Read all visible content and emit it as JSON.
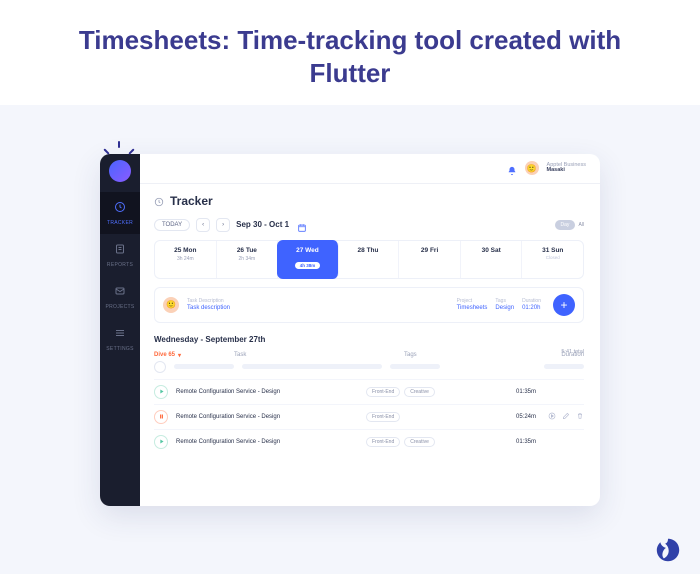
{
  "headline": "Timesheets: Time-tracking tool created with Flutter",
  "header": {
    "breadcrumb": "Apptel Business",
    "user_name": "Masaki"
  },
  "sidebar": {
    "items": [
      {
        "label": "TRACKER",
        "icon": "clock"
      },
      {
        "label": "REPORTS",
        "icon": "report"
      },
      {
        "label": "PROJECTS",
        "icon": "mail"
      },
      {
        "label": "SETTINGS",
        "icon": "stack"
      }
    ]
  },
  "tracker": {
    "title": "Tracker",
    "today_btn": "TODAY",
    "date_range": "Sep 30 - Oct 1",
    "toggle_active": "Day",
    "toggle_other": "All",
    "week": [
      {
        "label": "25 Mon",
        "dur": "3h 24m"
      },
      {
        "label": "26 Tue",
        "dur": "2h 34m"
      },
      {
        "label": "27 Wed",
        "badge": "4h 38m",
        "active": true
      },
      {
        "label": "28 Thu"
      },
      {
        "label": "29 Fri"
      },
      {
        "label": "30 Sat"
      },
      {
        "label": "31 Sun",
        "sub": "Closed"
      }
    ],
    "entry": {
      "desc_h": "Task Description",
      "desc_v": "Task description",
      "proj_h": "Project",
      "proj_v": "Timesheets",
      "tags_h": "Tags",
      "tags_v": "Design",
      "dur_h": "Duration",
      "dur_v": "01:20h"
    },
    "section_title": "Wednesday - September 27th",
    "sum_label": "5:41 total",
    "cols": {
      "person": "Dive 65",
      "task": "Task",
      "tags": "Tags",
      "dur": "Duration"
    },
    "rows": [
      {
        "icon": "play",
        "icon_color": "#53c6a2",
        "name": "Remote Configuration Service - Design",
        "tags": [
          "Front-End",
          "Creative"
        ],
        "dur": "01:35m",
        "actions": false
      },
      {
        "icon": "pause",
        "icon_color": "#ff6a3d",
        "name": "Remote Configuration Service - Design",
        "tags": [
          "Front-End"
        ],
        "dur": "05:24m",
        "actions": true
      },
      {
        "icon": "play",
        "icon_color": "#53c6a2",
        "name": "Remote Configuration Service - Design",
        "tags": [
          "Front-End",
          "Creative"
        ],
        "dur": "01:35m",
        "actions": false
      }
    ]
  }
}
